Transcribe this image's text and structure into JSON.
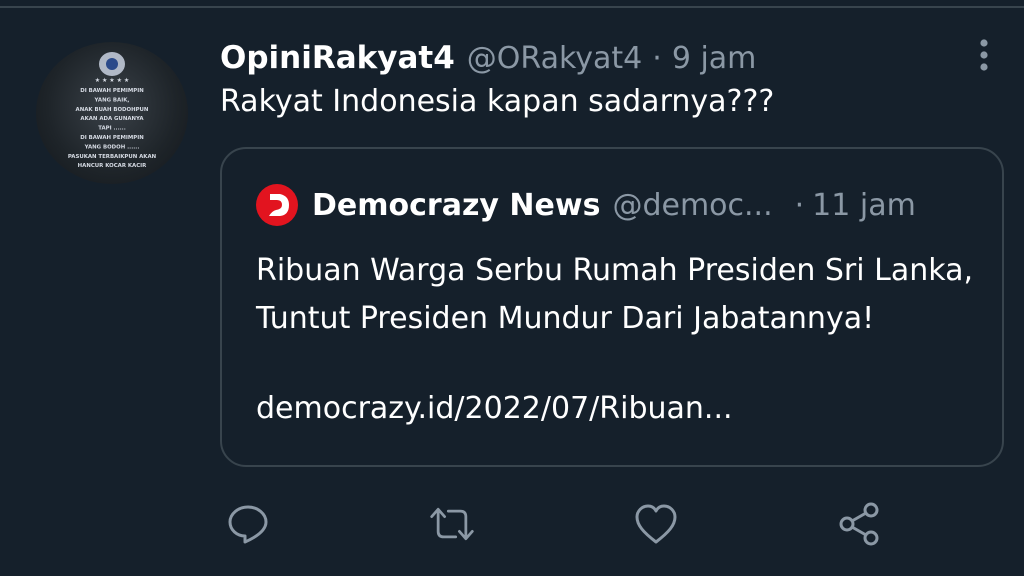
{
  "tweet": {
    "author_name": "OpiniRakyat4",
    "author_handle": "@ORakyat4",
    "separator": "·",
    "time": "9 jam",
    "text": "Rakyat Indonesia kapan sadarnya???",
    "avatar_lines": [
      "DI BAWAH PEMIMPIN",
      "YANG BAIK,",
      "ANAK BUAH BODOHPUN",
      "AKAN ADA GUNANYA",
      "TAPI ......",
      "DI BAWAH PEMIMPIN",
      "YANG BODOH ......",
      "PASUKAN TERBAIKPUN AKAN",
      "HANCUR KOCAR KACIR"
    ]
  },
  "quote": {
    "avatar_letter": "D",
    "author_name": "Democrazy News",
    "author_handle": "@democ...",
    "separator": "·",
    "time": "11 jam",
    "text": "Ribuan Warga Serbu Rumah Presiden Sri Lanka, Tuntut Presiden Mundur Dari Jabatannya!",
    "link": "democrazy.id/2022/07/Ribuan..."
  },
  "icons": {
    "more": "more-vertical-icon",
    "reply": "reply-icon",
    "retweet": "retweet-icon",
    "like": "like-icon",
    "share": "share-icon"
  },
  "colors": {
    "background": "#15202b",
    "border": "#38444d",
    "secondary_text": "#8b98a5",
    "quote_avatar": "#e2141f"
  }
}
